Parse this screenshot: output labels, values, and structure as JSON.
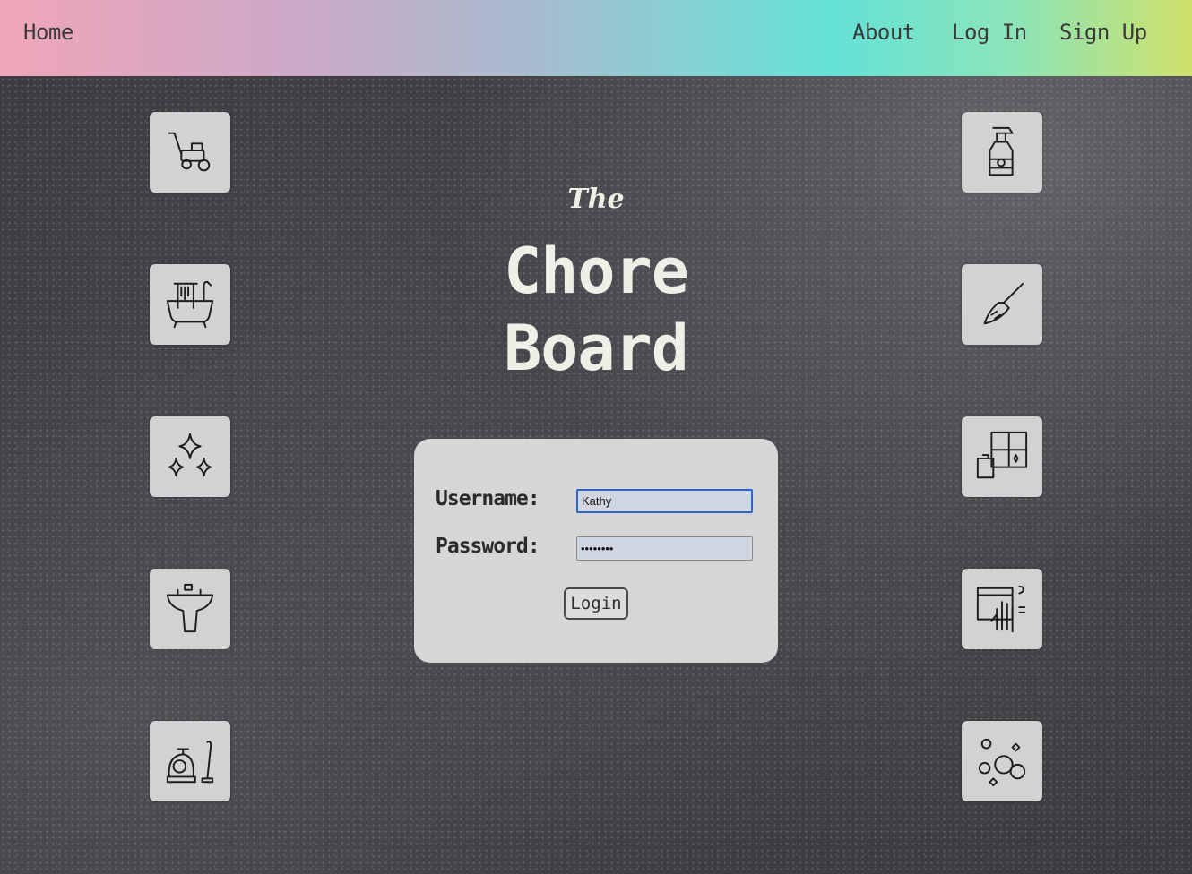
{
  "nav": {
    "home": "Home",
    "about": "About",
    "login": "Log In",
    "signup": "Sign Up"
  },
  "hero": {
    "the": "The",
    "line1": "Chore",
    "line2": "Board"
  },
  "login_form": {
    "username_label": "Username:",
    "password_label": "Password:",
    "username_value": "Kathy",
    "password_value": "••••••••",
    "submit_label": "Login"
  },
  "icons": {
    "left": [
      "lawn-mower-icon",
      "bathtub-icon",
      "sparkles-icon",
      "sink-icon",
      "vacuum-cleaner-icon"
    ],
    "right": [
      "spray-bottle-icon",
      "broom-icon",
      "window-cleaning-icon",
      "wiping-hand-icon",
      "bubbles-icon"
    ]
  },
  "colors": {
    "nav_gradient": [
      "#f0a6b9",
      "#a6bccd",
      "#64e2d6",
      "#cfe06a"
    ],
    "board": "#3d3b3f",
    "tile": "#d2d2d3",
    "title_text": "#efefe8",
    "focus_border": "#2e63c7"
  }
}
